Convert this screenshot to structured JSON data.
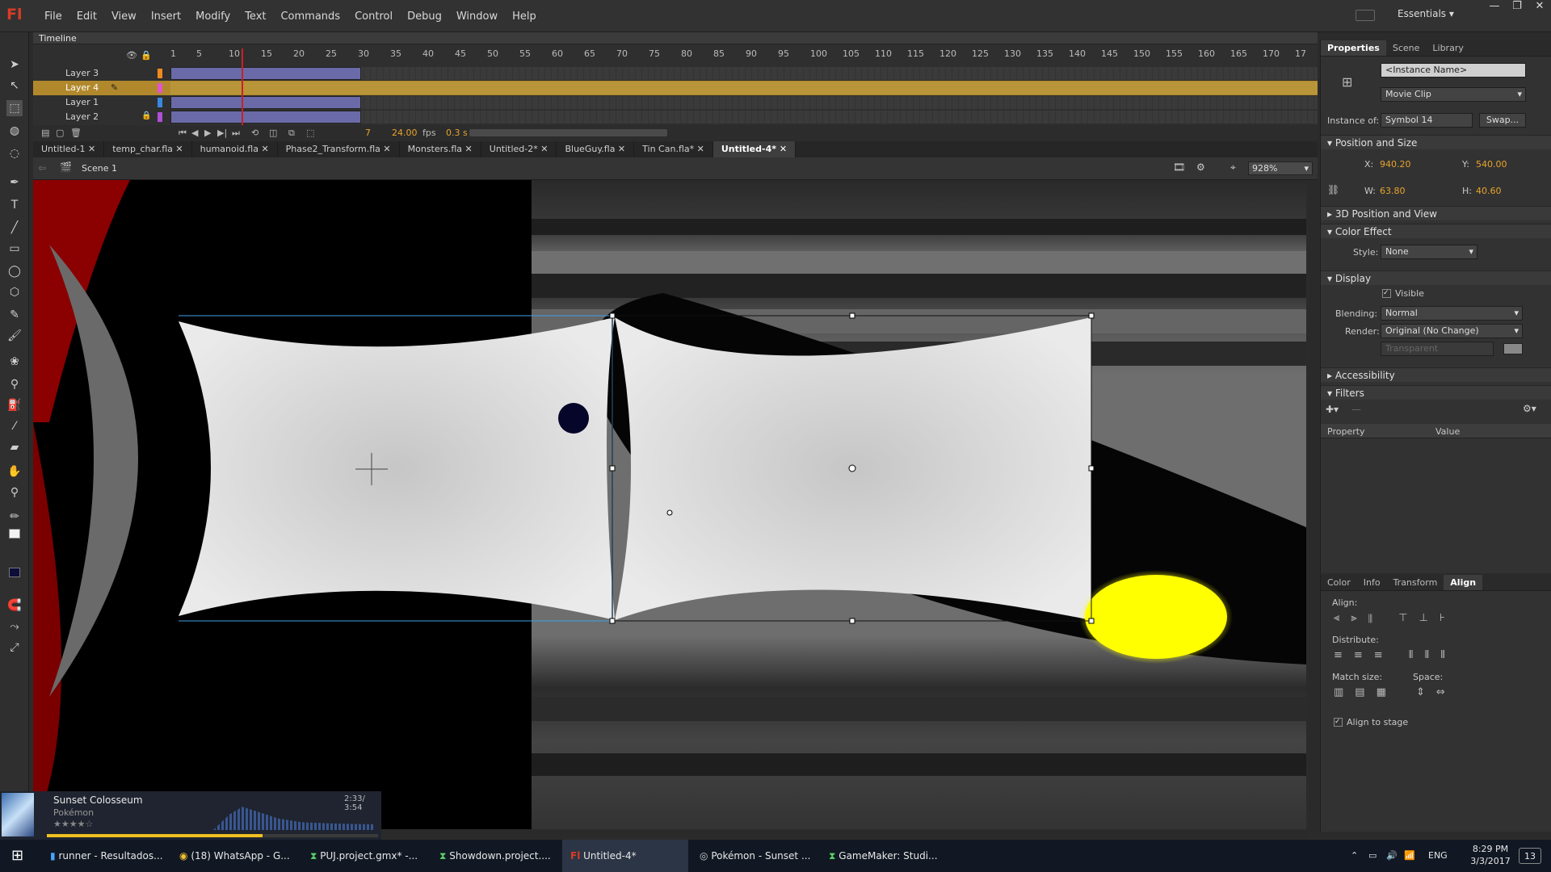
{
  "app": {
    "logo": "Fl",
    "workspace": "Essentials"
  },
  "menu": [
    "File",
    "Edit",
    "View",
    "Insert",
    "Modify",
    "Text",
    "Commands",
    "Control",
    "Debug",
    "Window",
    "Help"
  ],
  "timeline": {
    "title": "Timeline",
    "ruler": [
      "1",
      "5",
      "10",
      "15",
      "20",
      "25",
      "30",
      "35",
      "40",
      "45",
      "50",
      "55",
      "60",
      "65",
      "70",
      "75",
      "80",
      "85",
      "90",
      "95",
      "100",
      "105",
      "110",
      "115",
      "120",
      "125",
      "130",
      "135",
      "140",
      "145",
      "150",
      "155",
      "160",
      "165",
      "170",
      "17"
    ],
    "layers": [
      {
        "name": "Layer 3",
        "color": "#f08a1e"
      },
      {
        "name": "Layer 4",
        "color": "#e055c8",
        "selected": true
      },
      {
        "name": "Layer 1",
        "color": "#3a86e0"
      },
      {
        "name": "Layer 2",
        "color": "#b04fd8"
      }
    ],
    "current_frame": "7",
    "fps": "24.00",
    "fps_unit": "fps",
    "time": "0.3 s"
  },
  "doc_tabs": [
    "Untitled-1",
    "temp_char.fla",
    "humanoid.fla",
    "Phase2_Transform.fla",
    "Monsters.fla",
    "Untitled-2*",
    "BlueGuy.fla",
    "Tin Can.fla*",
    "Untitled-4*"
  ],
  "active_tab": "Untitled-4*",
  "scene": {
    "label": "Scene 1",
    "zoom": "928%"
  },
  "properties": {
    "tabs": [
      "Properties",
      "Scene",
      "Library"
    ],
    "instance_name_placeholder": "<Instance Name>",
    "symbol_type": "Movie Clip",
    "instance_of_label": "Instance of:",
    "instance_of": "Symbol 14",
    "swap": "Swap...",
    "pos_size": "Position and Size",
    "x_label": "X:",
    "x": "940.20",
    "y_label": "Y:",
    "y": "540.00",
    "w_label": "W:",
    "w": "63.80",
    "h_label": "H:",
    "h": "40.60",
    "pos3d": "3D Position and View",
    "color_effect": "Color Effect",
    "style_label": "Style:",
    "style": "None",
    "display": "Display",
    "visible": "Visible",
    "blending_label": "Blending:",
    "blending": "Normal",
    "render_label": "Render:",
    "render": "Original (No Change)",
    "transparent": "Transparent",
    "accessibility": "Accessibility",
    "filters": "Filters",
    "col_property": "Property",
    "col_value": "Value"
  },
  "align_panel": {
    "tabs": [
      "Color",
      "Info",
      "Transform",
      "Align"
    ],
    "align": "Align:",
    "distribute": "Distribute:",
    "match_size": "Match size:",
    "space": "Space:",
    "align_to_stage": "Align to stage"
  },
  "music": {
    "title": "Sunset Colosseum",
    "artist": "Pokémon",
    "time": "2:33/ 3:54",
    "progress": 0.65
  },
  "taskbar": {
    "items": [
      "runner - Resultados...",
      "(18) WhatsApp - G...",
      "PUJ.project.gmx* -...",
      "Showdown.project....",
      "Untitled-4*",
      "Pokémon - Sunset ...",
      "GameMaker: Studi..."
    ],
    "lang": "ENG",
    "time": "8:29 PM",
    "date": "3/3/2017",
    "notifications": "13"
  }
}
